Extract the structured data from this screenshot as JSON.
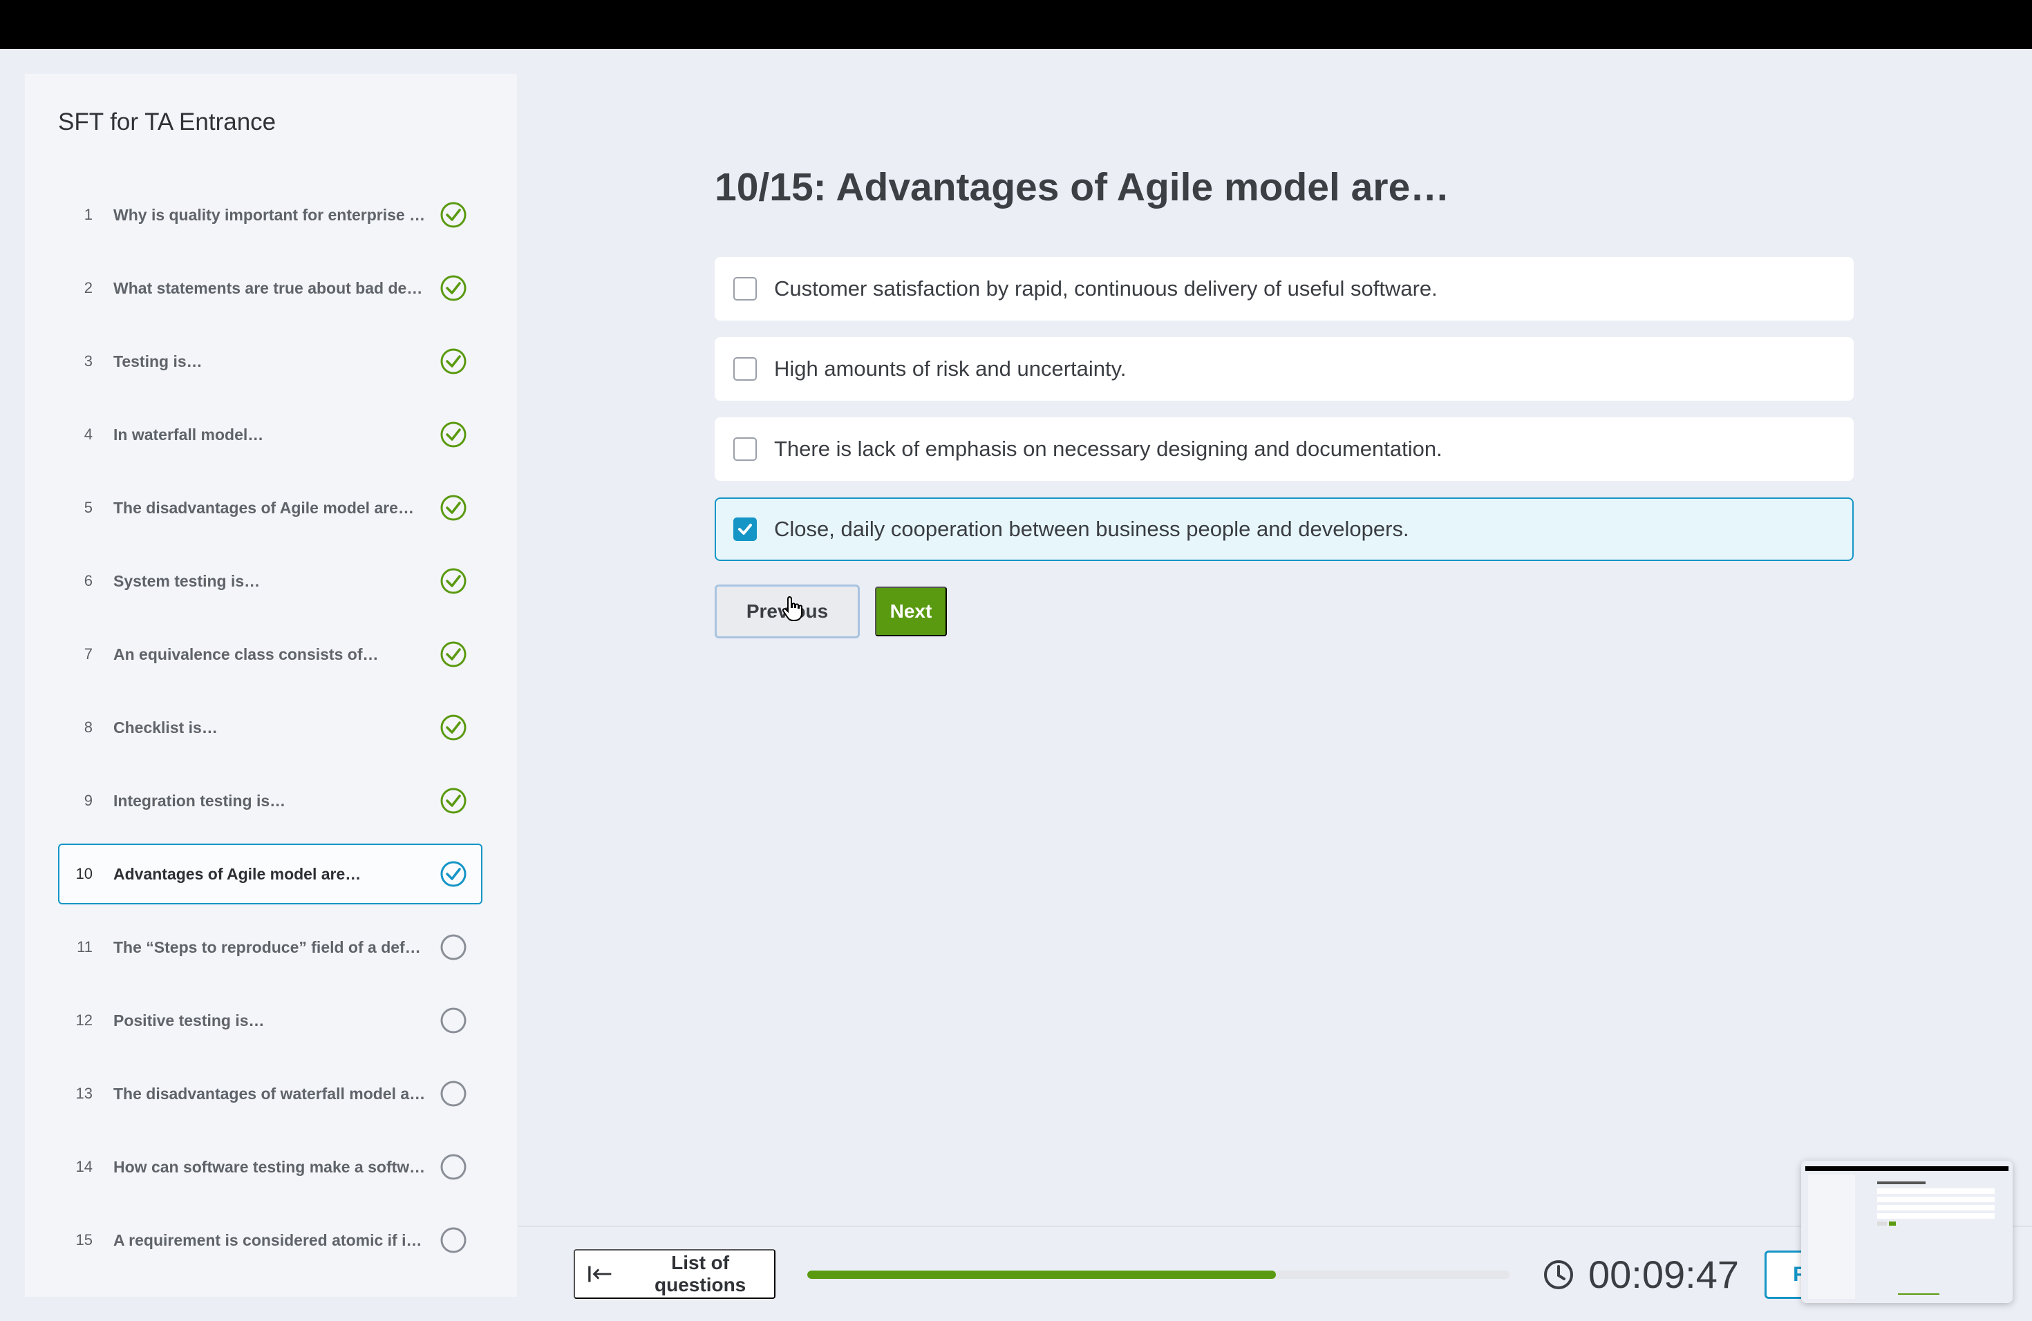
{
  "sidebar": {
    "title": "SFT for TA Entrance",
    "questions": [
      {
        "num": "1",
        "text": "Why is quality important for enterprise u…",
        "status": "answered"
      },
      {
        "num": "2",
        "text": "What statements are true about bad defe…",
        "status": "answered"
      },
      {
        "num": "3",
        "text": "Testing is…",
        "status": "answered"
      },
      {
        "num": "4",
        "text": "In waterfall model…",
        "status": "answered"
      },
      {
        "num": "5",
        "text": "The disadvantages of Agile model are…",
        "status": "answered"
      },
      {
        "num": "6",
        "text": "System testing is…",
        "status": "answered"
      },
      {
        "num": "7",
        "text": "An equivalence class consists of…",
        "status": "answered"
      },
      {
        "num": "8",
        "text": "Checklist is…",
        "status": "answered"
      },
      {
        "num": "9",
        "text": "Integration testing is…",
        "status": "answered"
      },
      {
        "num": "10",
        "text": "Advantages of Agile model are…",
        "status": "current"
      },
      {
        "num": "11",
        "text": "The “Steps to reproduce” field of a defec…",
        "status": "unanswered"
      },
      {
        "num": "12",
        "text": "Positive testing is…",
        "status": "unanswered"
      },
      {
        "num": "13",
        "text": "The disadvantages of waterfall model ar…",
        "status": "unanswered"
      },
      {
        "num": "14",
        "text": "How can software testing make a softwar…",
        "status": "unanswered"
      },
      {
        "num": "15",
        "text": "A requirement is considered atomic if it…",
        "status": "unanswered"
      }
    ]
  },
  "question": {
    "title": "10/15: Advantages of Agile model are…",
    "answers": [
      {
        "text": "Customer satisfaction by rapid, continuous delivery of useful software.",
        "checked": false
      },
      {
        "text": "High amounts of risk and uncertainty.",
        "checked": false
      },
      {
        "text": "There is lack of emphasis on necessary designing and documentation.",
        "checked": false
      },
      {
        "text": "Close, daily cooperation between business people and developers.",
        "checked": true
      }
    ]
  },
  "nav": {
    "previous_label": "Previous",
    "next_label": "Next"
  },
  "footer": {
    "list_label": "List of questions",
    "progress": 0.667,
    "timer": "00:09:47",
    "finish_label": "Fi"
  },
  "colors": {
    "accent": "#1595c6",
    "success": "#5a9a10",
    "unanswered": "#8a8f97"
  },
  "icons": {
    "answered": "check-circle-icon",
    "current": "check-circle-icon",
    "unanswered": "empty-circle-icon",
    "list": "arrow-left-bar-icon",
    "timer": "clock-icon",
    "cursor": "hand-cursor-icon"
  }
}
